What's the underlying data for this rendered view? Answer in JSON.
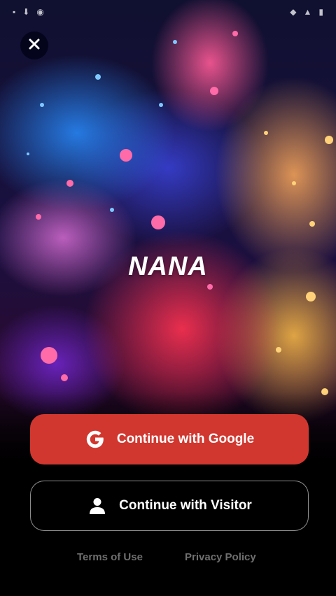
{
  "app": {
    "logo_text": "NANA"
  },
  "buttons": {
    "google_label": "Continue with Google",
    "visitor_label": "Continue with Visitor"
  },
  "footer": {
    "terms_label": "Terms of Use",
    "privacy_label": "Privacy Policy"
  },
  "icons": {
    "close": "close-icon",
    "google": "google-icon",
    "visitor": "person-icon"
  },
  "colors": {
    "google_button": "#d1372f",
    "visitor_button_border": "#8c8c8c",
    "footer_link": "#6f6f6f"
  }
}
